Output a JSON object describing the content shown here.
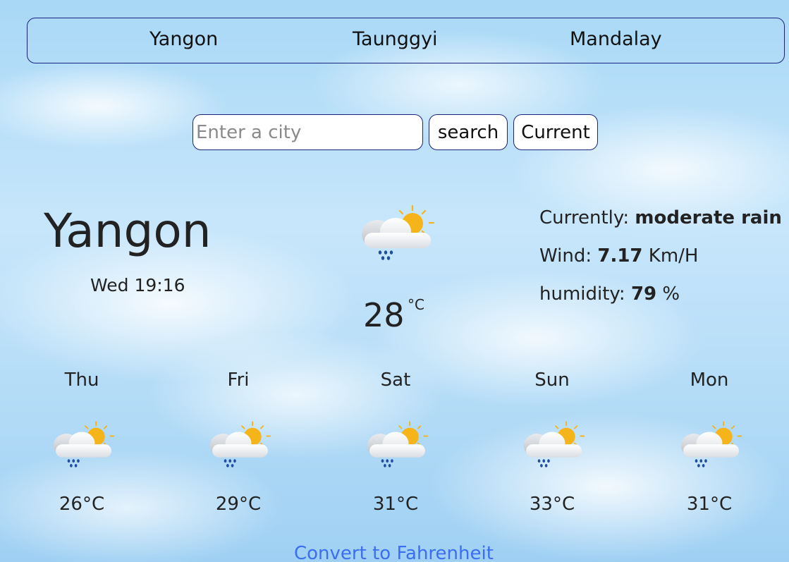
{
  "nav": {
    "cities": [
      "Yangon",
      "Taunggyi",
      "Mandalay"
    ]
  },
  "search": {
    "placeholder": "Enter a city",
    "value": "",
    "search_label": "search",
    "current_label": "Current"
  },
  "current": {
    "city": "Yangon",
    "datetime": "Wed 19:16",
    "icon": "cloud-sun-rain-icon",
    "temperature": "28",
    "unit": "°C",
    "description_label": "Currently:",
    "description_value": "moderate rain",
    "wind_label": "Wind:",
    "wind_value": "7.17",
    "wind_unit": "Km/H",
    "humidity_label": "humidity:",
    "humidity_value": "79",
    "humidity_unit": "%"
  },
  "forecast": [
    {
      "day": "Thu",
      "temp": "26°C",
      "icon": "cloud-sun-rain-icon"
    },
    {
      "day": "Fri",
      "temp": "29°C",
      "icon": "cloud-sun-rain-icon"
    },
    {
      "day": "Sat",
      "temp": "31°C",
      "icon": "cloud-sun-rain-icon"
    },
    {
      "day": "Sun",
      "temp": "33°C",
      "icon": "cloud-sun-rain-icon"
    },
    {
      "day": "Mon",
      "temp": "31°C",
      "icon": "cloud-sun-rain-icon"
    }
  ],
  "convert_link": "Convert to Fahrenheit",
  "colors": {
    "border": "#1a237e",
    "link": "#3b6ef0",
    "sun": "#f4b41a",
    "rain": "#1f4e9c"
  }
}
